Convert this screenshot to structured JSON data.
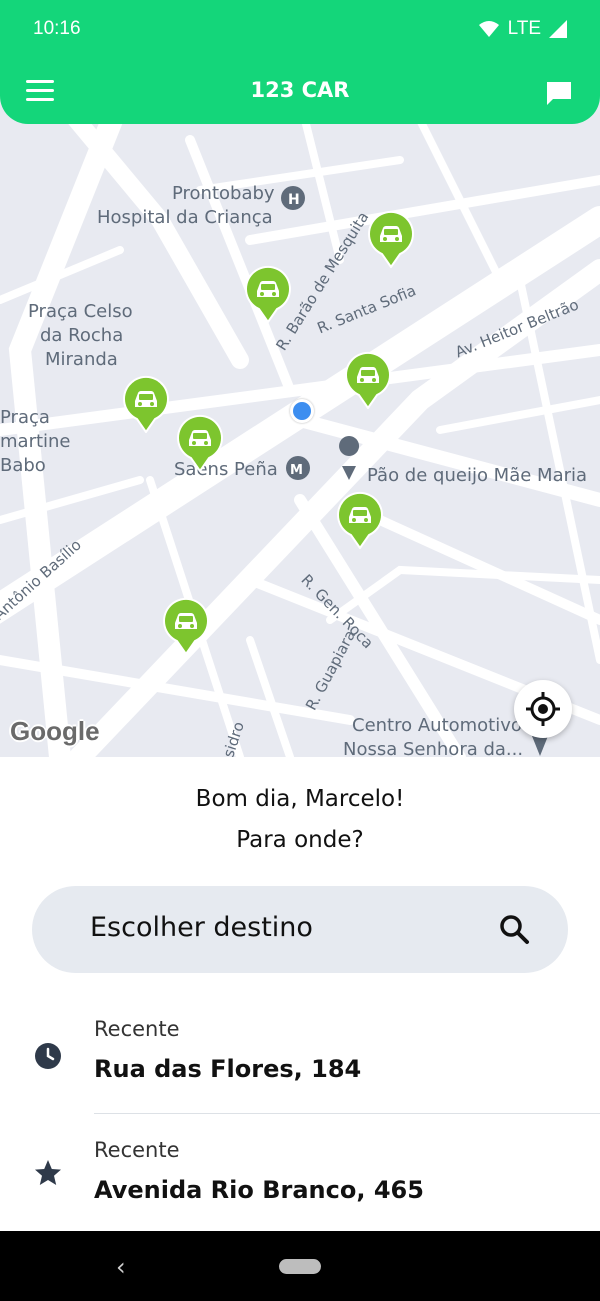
{
  "status": {
    "time": "10:16",
    "network": "LTE"
  },
  "appbar": {
    "title": "123 CAR",
    "menu_icon": "hamburger-menu-icon",
    "chat_icon": "chat-bubble-icon"
  },
  "map": {
    "labels": {
      "hospital": "Prontobaby",
      "hospital2": "Hospital da Criança",
      "praca1": "Praça Celso",
      "praca2": "da Rocha",
      "praca3": "Miranda",
      "praca_l1": "Praça",
      "praca_l2": "martine",
      "praca_l3": "Babo",
      "metro": "Saens Peña",
      "poi": "Pão de queijo Mãe Maria",
      "centro1": "Centro Automotivo",
      "centro2": "Nossa Senhora da...",
      "st_barao": "R. Barão de Mesquita",
      "st_sofia": "R. Santa Sofia",
      "st_heitor": "Av. Heitor Beltrão",
      "st_basilio": "Antônio Basílio",
      "st_roca": "R. Gen. Roca",
      "st_guapiara": "R. Guapiara",
      "st_isidro": "sidro"
    },
    "google": "Google",
    "marker_icon": "car-marker-icon",
    "locate_icon": "my-location-icon"
  },
  "panel": {
    "greeting": "Bom dia, Marcelo!",
    "question": "Para onde?",
    "search_label": "Escolher destino",
    "search_icon": "search-icon"
  },
  "recents": [
    {
      "sub": "Recente",
      "address": "Rua das Flores, 184",
      "icon": "clock-icon"
    },
    {
      "sub": "Recente",
      "address": "Avenida Rio Branco, 465",
      "icon": "star-icon"
    }
  ],
  "colors": {
    "brand": "#14d67a",
    "car": "#7dc52e",
    "map_bg": "#e8eaf1"
  }
}
